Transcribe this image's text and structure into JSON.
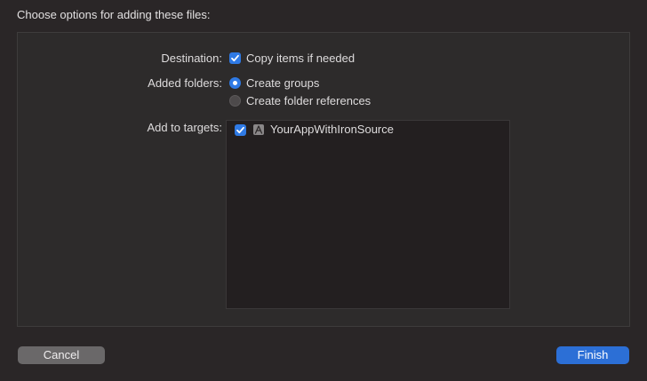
{
  "dialog": {
    "title": "Choose options for adding these files:"
  },
  "destination": {
    "label": "Destination:",
    "copy_items_label": "Copy items if needed",
    "copy_items_checked": true
  },
  "added_folders": {
    "label": "Added folders:",
    "options": [
      {
        "label": "Create groups",
        "selected": true
      },
      {
        "label": "Create folder references",
        "selected": false
      }
    ]
  },
  "targets": {
    "label": "Add to targets:",
    "items": [
      {
        "name": "YourAppWithIronSource",
        "checked": true,
        "icon": "app-target-icon"
      }
    ]
  },
  "buttons": {
    "cancel_label": "Cancel",
    "finish_label": "Finish"
  },
  "colors": {
    "accent": "#2f7ae5",
    "finish_button": "#2c6fd6",
    "background": "#2a2627"
  }
}
